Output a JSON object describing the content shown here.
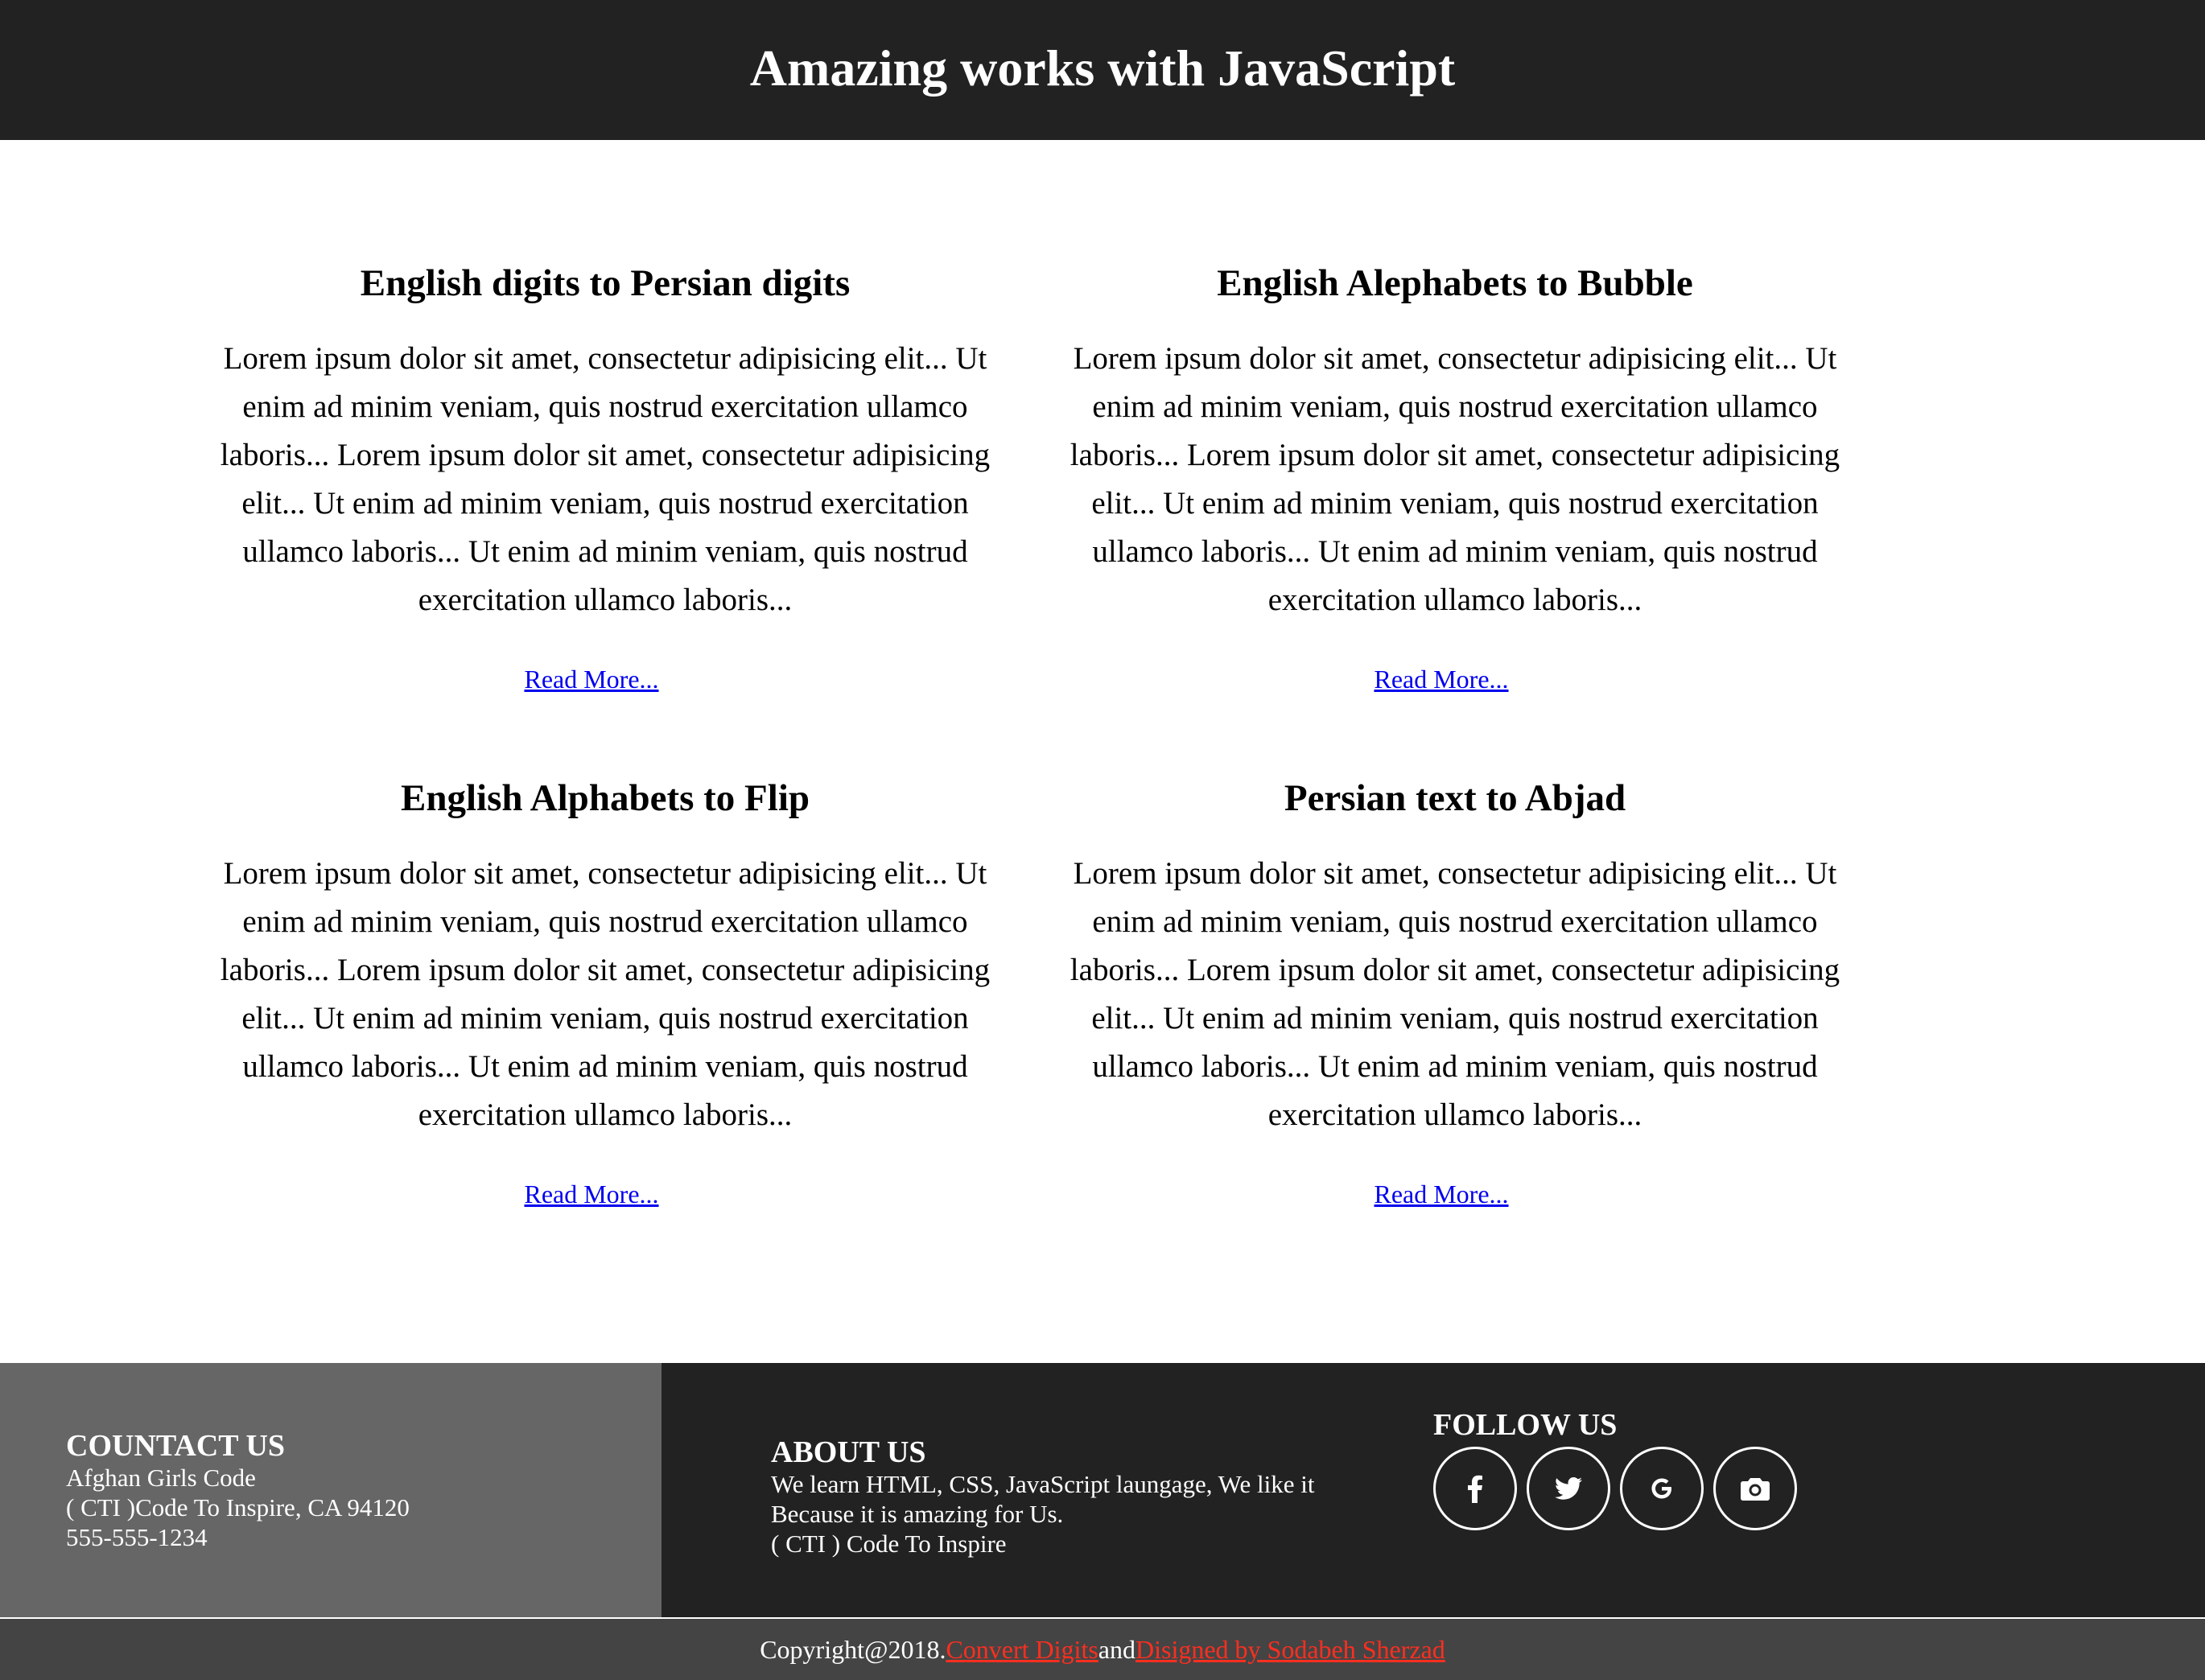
{
  "header": {
    "title": "Amazing works with JavaScript"
  },
  "cards": [
    {
      "title": "English digits to Persian digits",
      "body": "Lorem ipsum dolor sit amet, consectetur adipisicing elit... Ut enim ad minim veniam, quis nostrud exercitation ullamco laboris... Lorem ipsum dolor sit amet, consectetur adipisicing elit... Ut enim ad minim veniam, quis nostrud exercitation ullamco laboris... Ut enim ad minim veniam, quis nostrud exercitation ullamco laboris...",
      "link": "Read More..."
    },
    {
      "title": "English Alephabets to Bubble",
      "body": "Lorem ipsum dolor sit amet, consectetur adipisicing elit... Ut enim ad minim veniam, quis nostrud exercitation ullamco laboris... Lorem ipsum dolor sit amet, consectetur adipisicing elit... Ut enim ad minim veniam, quis nostrud exercitation ullamco laboris... Ut enim ad minim veniam, quis nostrud exercitation ullamco laboris...",
      "link": "Read More..."
    },
    {
      "title": "English Alphabets to Flip",
      "body": "Lorem ipsum dolor sit amet, consectetur adipisicing elit... Ut enim ad minim veniam, quis nostrud exercitation ullamco laboris... Lorem ipsum dolor sit amet, consectetur adipisicing elit... Ut enim ad minim veniam, quis nostrud exercitation ullamco laboris... Ut enim ad minim veniam, quis nostrud exercitation ullamco laboris...",
      "link": "Read More..."
    },
    {
      "title": "Persian text to Abjad",
      "body": "Lorem ipsum dolor sit amet, consectetur adipisicing elit... Ut enim ad minim veniam, quis nostrud exercitation ullamco laboris... Lorem ipsum dolor sit amet, consectetur adipisicing elit... Ut enim ad minim veniam, quis nostrud exercitation ullamco laboris... Ut enim ad minim veniam, quis nostrud exercitation ullamco laboris...",
      "link": "Read More..."
    }
  ],
  "footer": {
    "contact": {
      "heading": "COUNTACT US",
      "lines": [
        "Afghan Girls Code",
        "( CTI )Code To Inspire, CA 94120",
        "555-555-1234"
      ]
    },
    "about": {
      "heading": "ABOUT US",
      "lines": [
        "We learn HTML, CSS, JavaScript laungage, We like it",
        "Because it is amazing for Us.",
        "( CTI ) Code To Inspire"
      ]
    },
    "follow": {
      "heading": "FOLLOW US",
      "icons": [
        "facebook-icon",
        "twitter-icon",
        "google-icon",
        "camera-icon"
      ]
    },
    "copyright": {
      "prefix": "Copyright@2018.",
      "link1": "Convert Digits",
      "middle": "and",
      "link2": "Disigned by Sodabeh Sherzad"
    }
  },
  "colors": {
    "header_bg": "#222222",
    "contact_bg": "#666666",
    "copyright_bg": "#444444",
    "link_blue": "#0000ee",
    "link_red": "#ff2e1f"
  }
}
